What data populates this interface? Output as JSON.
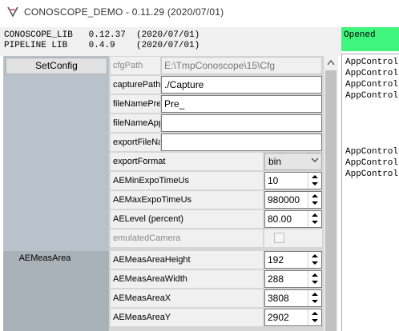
{
  "window": {
    "title": "CONOSCOPE_DEMO - 0.11.29 (2020/07/01)"
  },
  "versions": [
    {
      "name": "CONOSCOPE_LIB",
      "version": "0.12.37",
      "date": "(2020/07/01)"
    },
    {
      "name": "PIPELINE LIB",
      "version": "0.4.9",
      "date": "(2020/07/01)"
    }
  ],
  "status": {
    "text": "Opened",
    "color": "#3ff57c"
  },
  "log": {
    "lines": [
      "AppControl",
      "AppControl",
      "AppControl",
      "AppControl",
      "",
      "",
      "",
      "",
      "AppControl",
      "AppControl",
      "AppControl"
    ]
  },
  "config": {
    "button": "SetConfig",
    "section_label": "AEMeasArea",
    "rows": {
      "cfgPath": {
        "label": "cfgPath",
        "value": "E:\\TmpConoscope\\15\\Cfg"
      },
      "capturePath": {
        "label": "capturePath",
        "value": "./Capture"
      },
      "fileNamePrepend": {
        "label": "fileNamePrep",
        "value": "Pre_"
      },
      "fileNameAppend": {
        "label": "fileNameApp",
        "value": ""
      },
      "exportFileName": {
        "label": "exportFileNa",
        "value": ""
      },
      "exportFormat": {
        "label": "exportFormat",
        "value": "bin"
      },
      "AEMinExpoTimeUs": {
        "label": "AEMinExpoTimeUs",
        "value": "10"
      },
      "AEMaxExpoTimeUs": {
        "label": "AEMaxExpoTimeUs",
        "value": "980000"
      },
      "AELevel": {
        "label": "AELevel (percent)",
        "value": "80.00"
      },
      "emulatedCamera": {
        "label": "emulatedCamera",
        "checked": false
      },
      "AEMeasAreaHeight": {
        "label": "AEMeasAreaHeight",
        "value": "192"
      },
      "AEMeasAreaWidth": {
        "label": "AEMeasAreaWidth",
        "value": "288"
      },
      "AEMeasAreaX": {
        "label": "AEMeasAreaX",
        "value": "3808"
      },
      "AEMeasAreaY": {
        "label": "AEMeasAreaY",
        "value": "2902"
      }
    }
  }
}
